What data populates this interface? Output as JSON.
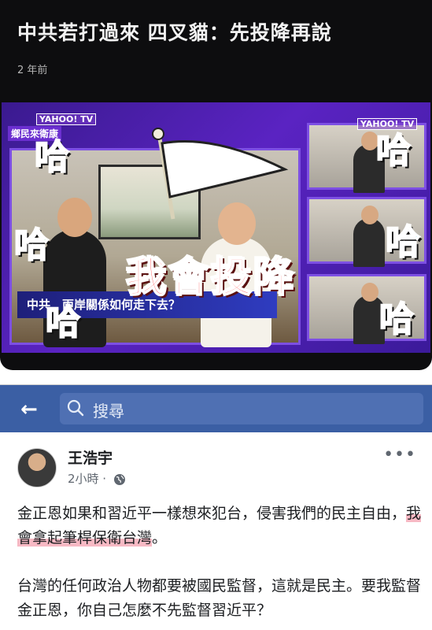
{
  "video": {
    "title": "中共若打過來 四叉貓：先投降再說",
    "age": "2 年前",
    "thumbnail": {
      "yahoo_logo": "YAHOO! TV",
      "show_name": "鄉民來衛康",
      "ticker": "中共　兩岸關係如何走下去？",
      "caption": "我會投降",
      "ha_text": "哈"
    }
  },
  "facebook": {
    "back_icon": "back-arrow-icon",
    "search_placeholder": "搜尋",
    "header_color": "#3b5fa4",
    "post": {
      "author": "王浩宇",
      "time": "2小時 ·",
      "privacy_icon": "globe-icon",
      "more_label": "•••",
      "paragraph1_a": "金正恩如果和習近平一樣想來犯台，侵害我們的民主自由，",
      "paragraph1_highlight": "我會拿起筆桿保衛台灣",
      "paragraph1_end": "。",
      "paragraph2": "台灣的任何政治人物都要被國民監督，這就是民主。要我監督金正恩，你自己怎麼不先監督習近平？"
    }
  }
}
